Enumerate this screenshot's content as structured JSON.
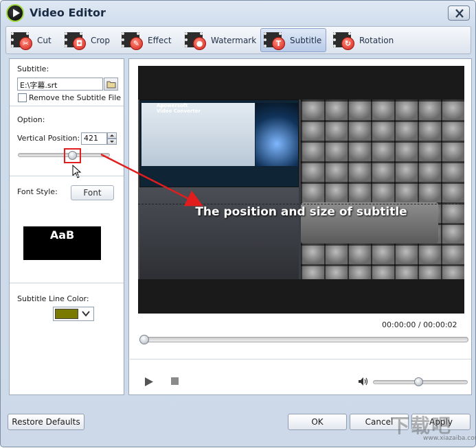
{
  "window": {
    "title": "Video Editor"
  },
  "toolbar": {
    "tabs": [
      {
        "label": "Cut",
        "icon": "scissors-icon"
      },
      {
        "label": "Crop",
        "icon": "crop-icon"
      },
      {
        "label": "Effect",
        "icon": "effect-icon"
      },
      {
        "label": "Watermark",
        "icon": "watermark-icon"
      },
      {
        "label": "Subtitle",
        "icon": "subtitle-icon",
        "active": true
      },
      {
        "label": "Rotation",
        "icon": "rotation-icon"
      }
    ]
  },
  "subtitle_panel": {
    "subtitle_label": "Subtitle:",
    "file_path": "E:\\字幕.srt",
    "remove_label": "Remove the Subtitle File",
    "remove_checked": false,
    "option_label": "Option:",
    "vertical_position_label": "Vertical Position:",
    "vertical_position_value": "421",
    "font_style_label": "Font Style:",
    "font_button": "Font",
    "font_preview": "AaB",
    "line_color_label": "Subtitle Line Color:",
    "line_color": "#7a7a00"
  },
  "preview": {
    "subtitle_text": "The position and size of subtitle",
    "screen_brand_1": "Apowersoft",
    "screen_brand_2": "Video Converter",
    "current_time": "00:00:00",
    "time_separator": "/",
    "total_time": "00:00:02",
    "playback_progress": 0,
    "volume": 0.5
  },
  "footer": {
    "restore_defaults": "Restore Defaults",
    "ok": "OK",
    "cancel": "Cancel",
    "apply": "Apply"
  },
  "watermark": {
    "text": "下载吧",
    "url": "www.xiazaiba.com"
  },
  "colors": {
    "accent": "#e21d1d",
    "active_tab": "#b9cbe8"
  }
}
